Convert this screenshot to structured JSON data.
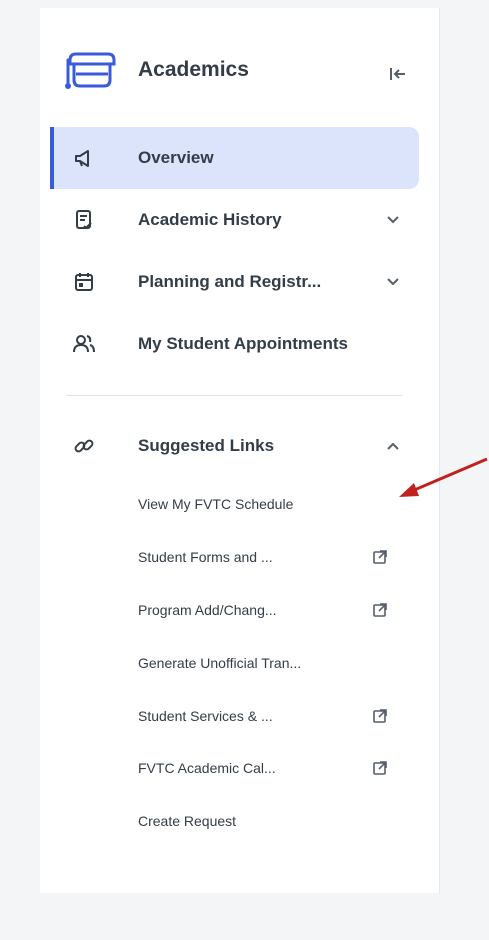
{
  "header": {
    "title": "Academics",
    "app_icon": "graduation-cap-icon",
    "collapse_icon": "collapse-left-icon"
  },
  "nav": {
    "items": [
      {
        "label": "Overview",
        "icon": "megaphone-icon",
        "active": true,
        "expandable": false
      },
      {
        "label": "Academic History",
        "icon": "document-check-icon",
        "active": false,
        "expandable": true
      },
      {
        "label": "Planning and Registr...",
        "icon": "calendar-icon",
        "active": false,
        "expandable": true
      },
      {
        "label": "My Student Appointments",
        "icon": "people-icon",
        "active": false,
        "expandable": false
      }
    ]
  },
  "suggested": {
    "label": "Suggested Links",
    "icon": "link-icon",
    "expanded": true,
    "links": [
      {
        "label": "View My FVTC Schedule",
        "external": false
      },
      {
        "label": "Student Forms and ...",
        "external": true
      },
      {
        "label": "Program Add/Chang...",
        "external": true
      },
      {
        "label": "Generate Unofficial Tran...",
        "external": false
      },
      {
        "label": "Student Services & ...",
        "external": true
      },
      {
        "label": "FVTC Academic Cal...",
        "external": true
      },
      {
        "label": "Create Request",
        "external": false
      }
    ]
  },
  "colors": {
    "accent": "#3a5bd9",
    "active_bg": "#dbe4fb",
    "annotation_arrow": "#c0201e"
  }
}
